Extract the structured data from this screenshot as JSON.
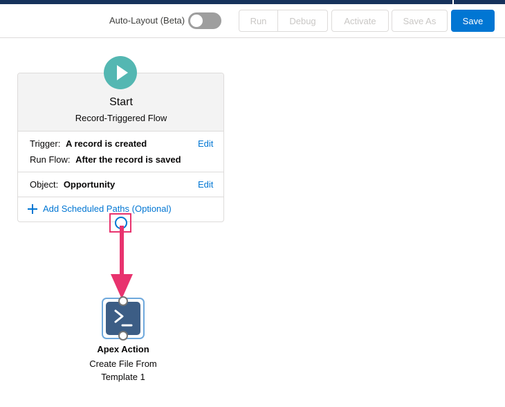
{
  "toolbar": {
    "auto_layout_label": "Auto-Layout (Beta)",
    "auto_layout_on": false,
    "run_label": "Run",
    "debug_label": "Debug",
    "activate_label": "Activate",
    "save_as_label": "Save As",
    "save_label": "Save"
  },
  "start": {
    "icon": "play-icon",
    "title": "Start",
    "subtitle": "Record-Triggered Flow",
    "trigger_label": "Trigger:",
    "trigger_value": "A record is created",
    "run_flow_label": "Run Flow:",
    "run_flow_value": "After the record is saved",
    "object_label": "Object:",
    "object_value": "Opportunity",
    "edit_label": "Edit",
    "add_paths_label": "Add Scheduled Paths (Optional)",
    "add_icon": "plus-icon"
  },
  "apex_action": {
    "icon": "apex-terminal-icon",
    "title": "Apex Action",
    "description_line1": "Create File From",
    "description_line2": "Template 1"
  },
  "colors": {
    "brand_blue": "#0176d3",
    "start_teal": "#54b7b2",
    "apex_navy": "#3c5d85",
    "highlight_pink": "#e8336e",
    "header_bar": "#16325c"
  }
}
